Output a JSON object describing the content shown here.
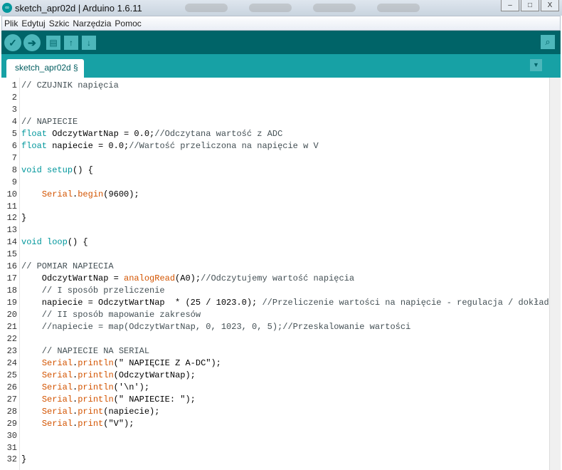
{
  "window": {
    "title": "sketch_apr02d | Arduino 1.6.11"
  },
  "menu": [
    "Plik",
    "Edytuj",
    "Szkic",
    "Narzędzia",
    "Pomoc"
  ],
  "toolbar": {
    "verify": "✓",
    "upload": "➔",
    "new": "▤",
    "open": "↑",
    "save": "↓",
    "serial_monitor": "⌕"
  },
  "tab": {
    "label": "sketch_apr02d §",
    "menu": "▼"
  },
  "code": [
    [
      [
        "// CZUJNIK napięcia",
        "c"
      ]
    ],
    [],
    [],
    [
      [
        "// NAPIECIE",
        "c"
      ]
    ],
    [
      [
        "float",
        "k"
      ],
      [
        " OdczytWartNap = 0.0;",
        "p"
      ],
      [
        "//Odczytana wartość z ADC",
        "c"
      ]
    ],
    [
      [
        "float",
        "k"
      ],
      [
        " napiecie = 0.0;",
        "p"
      ],
      [
        "//Wartość przeliczona na napięcie w V",
        "c"
      ]
    ],
    [],
    [
      [
        "void",
        "k"
      ],
      [
        " ",
        "p"
      ],
      [
        "setup",
        "k"
      ],
      [
        "() {",
        "p"
      ]
    ],
    [],
    [
      [
        "    ",
        "p"
      ],
      [
        "Serial",
        "o"
      ],
      [
        ".",
        "p"
      ],
      [
        "begin",
        "o"
      ],
      [
        "(9600);",
        "p"
      ]
    ],
    [],
    [
      [
        "}",
        "p"
      ]
    ],
    [],
    [
      [
        "void",
        "k"
      ],
      [
        " ",
        "p"
      ],
      [
        "loop",
        "k"
      ],
      [
        "() {",
        "p"
      ]
    ],
    [],
    [
      [
        "// POMIAR NAPIECIA",
        "c"
      ]
    ],
    [
      [
        "    OdczytWartNap = ",
        "p"
      ],
      [
        "analogRead",
        "o"
      ],
      [
        "(A0);",
        "p"
      ],
      [
        "//Odczytujemy wartość napięcia",
        "c"
      ]
    ],
    [
      [
        "    // I sposób przeliczenie",
        "c"
      ]
    ],
    [
      [
        "    napiecie = OdczytWartNap  * (25 / 1023.0); ",
        "p"
      ],
      [
        "//Przeliczenie wartości na napięcie - regulacja / dokładność",
        "c"
      ]
    ],
    [
      [
        "    // II sposób mapowanie zakresów",
        "c"
      ]
    ],
    [
      [
        "    //napiecie = map(OdczytWartNap, 0, 1023, 0, 5);//Przeskalowanie wartości",
        "c"
      ]
    ],
    [],
    [
      [
        "    // NAPIECIE NA SERIAL",
        "c"
      ]
    ],
    [
      [
        "    ",
        "p"
      ],
      [
        "Serial",
        "o"
      ],
      [
        ".",
        "p"
      ],
      [
        "println",
        "o"
      ],
      [
        "(\" NAPIĘCIE Z A-DC\");",
        "p"
      ]
    ],
    [
      [
        "    ",
        "p"
      ],
      [
        "Serial",
        "o"
      ],
      [
        ".",
        "p"
      ],
      [
        "println",
        "o"
      ],
      [
        "(OdczytWartNap);",
        "p"
      ]
    ],
    [
      [
        "    ",
        "p"
      ],
      [
        "Serial",
        "o"
      ],
      [
        ".",
        "p"
      ],
      [
        "println",
        "o"
      ],
      [
        "('\\n');",
        "p"
      ]
    ],
    [
      [
        "    ",
        "p"
      ],
      [
        "Serial",
        "o"
      ],
      [
        ".",
        "p"
      ],
      [
        "println",
        "o"
      ],
      [
        "(\" NAPIECIE: \");",
        "p"
      ]
    ],
    [
      [
        "    ",
        "p"
      ],
      [
        "Serial",
        "o"
      ],
      [
        ".",
        "p"
      ],
      [
        "print",
        "o"
      ],
      [
        "(napiecie);",
        "p"
      ]
    ],
    [
      [
        "    ",
        "p"
      ],
      [
        "Serial",
        "o"
      ],
      [
        ".",
        "p"
      ],
      [
        "print",
        "o"
      ],
      [
        "(\"V\");",
        "p"
      ]
    ],
    [],
    [],
    [
      [
        "}",
        "p"
      ]
    ]
  ]
}
